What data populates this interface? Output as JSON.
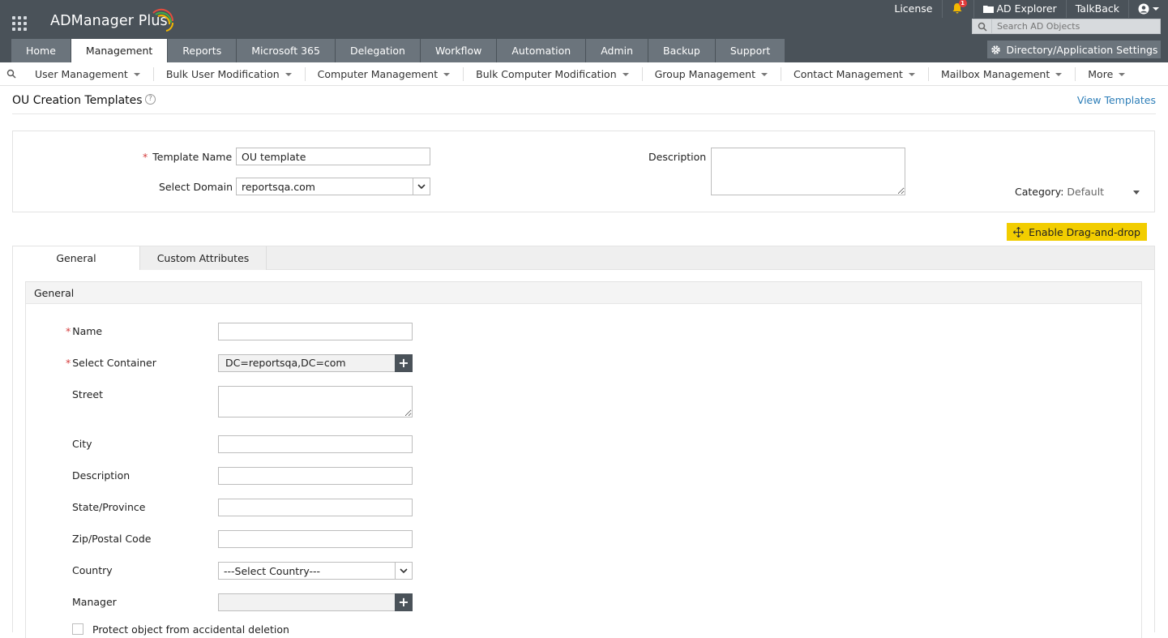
{
  "app": {
    "name": "ADManager Plus"
  },
  "top_links": {
    "license": "License",
    "notif_count": "1",
    "ad_explorer": "AD Explorer",
    "talkback": "TalkBack"
  },
  "search": {
    "placeholder": "Search AD Objects"
  },
  "main_tabs": [
    "Home",
    "Management",
    "Reports",
    "Microsoft 365",
    "Delegation",
    "Workflow",
    "Automation",
    "Admin",
    "Backup",
    "Support"
  ],
  "active_tab": "Management",
  "dir_settings": "Directory/Application Settings",
  "sub_nav": [
    "User Management",
    "Bulk User Modification",
    "Computer Management",
    "Bulk Computer Modification",
    "Group Management",
    "Contact Management",
    "Mailbox Management",
    "More"
  ],
  "page": {
    "title": "OU Creation Templates",
    "help": "?",
    "view_templates": "View Templates"
  },
  "template": {
    "name_label": "Template Name",
    "name_value": "OU template",
    "domain_label": "Select Domain",
    "domain_value": "reportsqa.com",
    "description_label": "Description",
    "category_label": "Category:",
    "category_value": "Default"
  },
  "drag_button": "Enable Drag-and-drop",
  "form_tabs": {
    "general": "General",
    "custom": "Custom Attributes"
  },
  "section": {
    "title": "General"
  },
  "fields": {
    "name": "Name",
    "container": "Select Container",
    "container_value": "DC=reportsqa,DC=com",
    "street": "Street",
    "city": "City",
    "description": "Description",
    "state": "State/Province",
    "zip": "Zip/Postal Code",
    "country": "Country",
    "country_value": "---Select Country---",
    "manager": "Manager",
    "protect": "Protect object from accidental deletion"
  },
  "colors": {
    "topbar": "#4a5259",
    "tab": "#6b747c",
    "accent_yellow": "#f2cd00",
    "link": "#2d7eb8",
    "required": "#d43b3b"
  }
}
